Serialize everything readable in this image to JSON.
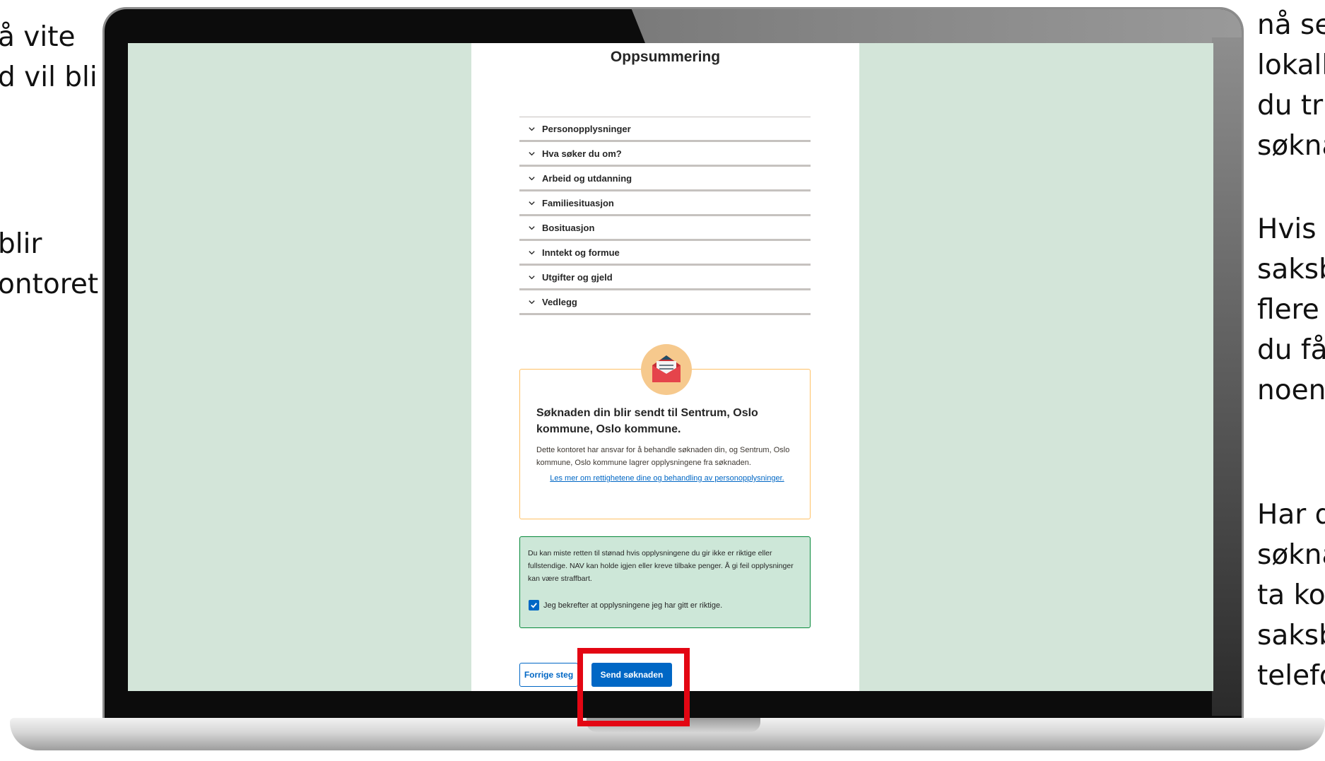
{
  "slide": {
    "left_text_1": [
      "å vite",
      "d vil bli"
    ],
    "left_text_2": [
      "blir",
      "ontoret"
    ],
    "right_text_1": [
      "nå se",
      "lokall",
      "du tr",
      "søkna"
    ],
    "right_text_2": [
      "Hvis",
      "saksb",
      "flere",
      "du få",
      "noen"
    ],
    "right_text_3": [
      "Har d",
      "søkna",
      "ta ko",
      "saksb",
      "telefo"
    ]
  },
  "page": {
    "title": "Oppsummering",
    "sections": [
      "Personopplysninger",
      "Hva søker du om?",
      "Arbeid og utdanning",
      "Familiesituasjon",
      "Bosituasjon",
      "Inntekt og formue",
      "Utgifter og gjeld",
      "Vedlegg"
    ],
    "info": {
      "title": "Søknaden din blir sendt til Sentrum, Oslo kommune, Oslo kommune.",
      "text": "Dette kontoret har ansvar for å behandle søknaden din, og Sentrum, Oslo kommune, Oslo kommune lagrer opplysningene fra søknaden.",
      "link": "Les mer om rettighetene dine og behandling av personopplysninger."
    },
    "warning": {
      "text": "Du kan miste retten til stønad hvis opplysningene du gir ikke er riktige eller fullstendige. NAV kan holde igjen eller kreve tilbake penger. Å gi feil opplysninger kan være straffbart.",
      "confirm_label": "Jeg bekrefter at opplysningene jeg har gitt er riktige.",
      "confirm_checked": true
    },
    "buttons": {
      "previous": "Forrige steg",
      "send": "Send søknaden"
    }
  },
  "colors": {
    "screen_background": "#d3e5d9",
    "primary_blue": "#0067c5",
    "warning_green": "#cde7d8",
    "info_border": "#ffc166",
    "highlight_red": "#e30613"
  },
  "icons": [
    "chevron-down-icon",
    "envelope-icon",
    "checkmark-icon"
  ]
}
